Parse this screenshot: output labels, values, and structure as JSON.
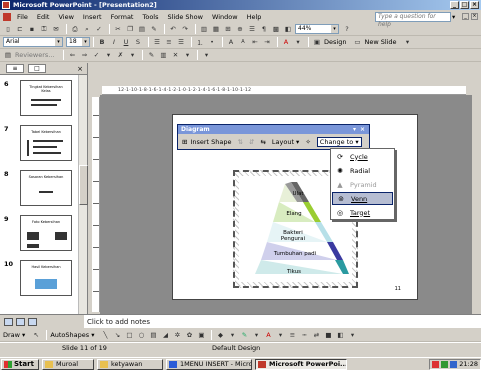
{
  "window": {
    "title": "Microsoft PowerPoint - [Presentation2]",
    "controls": [
      "_",
      "□",
      "×"
    ]
  },
  "menubar": {
    "items": [
      "File",
      "Edit",
      "View",
      "Insert",
      "Format",
      "Tools",
      "Slide Show",
      "Window",
      "Help"
    ],
    "help_placeholder": "Type a question for help",
    "doc_controls": [
      "_",
      "×"
    ]
  },
  "toolbar_standard": {
    "zoom": "44%"
  },
  "toolbar_formatting": {
    "font": "Arial",
    "size": "18",
    "bold": "B",
    "italic": "I",
    "underline": "U",
    "shadow": "S",
    "design_label": "Design",
    "new_slide_label": "New Slide"
  },
  "toolbar_reviewing": {
    "label": "Reviewers..."
  },
  "left_pane": {
    "tabs": [
      "≡",
      "□"
    ],
    "thumbnails": [
      {
        "num": "6",
        "text": "Tingkat Kebersihan Kelas"
      },
      {
        "num": "7",
        "text": "Tabel Kebersihan"
      },
      {
        "num": "8",
        "text": "Sasaran Kebersihan"
      },
      {
        "num": "9",
        "text": "Foto Kebersihan"
      },
      {
        "num": "10",
        "text": "Hasil Kebersihan"
      }
    ]
  },
  "ruler": {
    "h_ticks": "12·1·10·1·8·1·6·1·4·1·2·1·0·1·2·1·4·1·6·1·8·1·10·1·12"
  },
  "diagram": {
    "labels": [
      "Ulat",
      "Elang",
      "Bakteri Pengurai",
      "Tumbuhan padi",
      "Tikus"
    ],
    "slide_number": "11"
  },
  "diagram_toolbar": {
    "title": "Diagram",
    "close": "×",
    "insert_shape": "Insert Shape",
    "layout": "Layout ▾",
    "change_to": "Change to ▾"
  },
  "change_to_menu": {
    "options": [
      {
        "label": "Cycle",
        "icon": "cycle-icon",
        "disabled": false
      },
      {
        "label": "Radial",
        "icon": "radial-icon",
        "disabled": false
      },
      {
        "label": "Pyramid",
        "icon": "pyramid-icon",
        "disabled": true
      },
      {
        "label": "Venn",
        "icon": "venn-icon",
        "disabled": false
      },
      {
        "label": "Target",
        "icon": "target-icon",
        "disabled": false
      }
    ]
  },
  "notes": {
    "placeholder": "Click to add notes"
  },
  "drawing_toolbar": {
    "draw": "Draw ▾",
    "autoshapes": "AutoShapes ▾"
  },
  "statusbar": {
    "slide_info": "Slide 11 of 19",
    "design": "Default Design"
  },
  "taskbar": {
    "start": "Start",
    "tasks": [
      {
        "label": "Muroal",
        "active": false
      },
      {
        "label": "ketyawan",
        "active": false
      },
      {
        "label": "1MENU INSERT - Micros...",
        "active": false
      },
      {
        "label": "Microsoft PowerPoi...",
        "active": true
      }
    ],
    "clock": "21:28"
  },
  "colors": {
    "title_bar_start": "#0a246a",
    "title_bar_end": "#a6caf0",
    "diagram_toolbar_title": "#7a96d9",
    "menu_highlight": "#b6bdd2"
  }
}
